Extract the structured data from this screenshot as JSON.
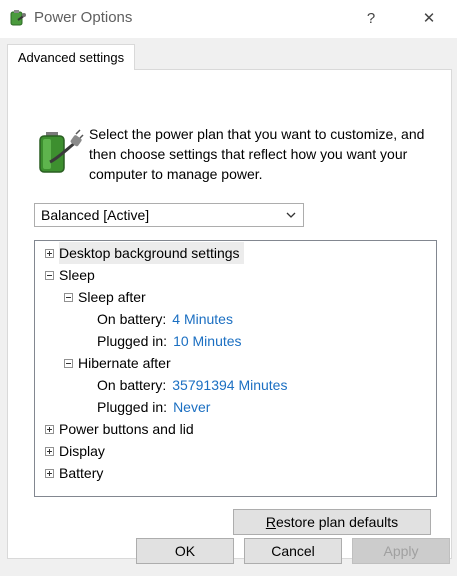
{
  "window": {
    "title": "Power Options",
    "help_label": "?",
    "close_label": "✕"
  },
  "tab": {
    "label": "Advanced settings"
  },
  "description": "Select the power plan that you want to customize, and then choose settings that reflect how you want your computer to manage power.",
  "plan_select": {
    "value": "Balanced [Active]"
  },
  "tree": {
    "desktop_background": "Desktop background settings",
    "sleep": "Sleep",
    "sleep_after": "Sleep after",
    "sleep_on_battery_label": "On battery:",
    "sleep_on_battery_value": "4 Minutes",
    "sleep_plugged_label": "Plugged in:",
    "sleep_plugged_value": "10 Minutes",
    "hibernate_after": "Hibernate after",
    "hibernate_on_battery_label": "On battery:",
    "hibernate_on_battery_value": "35791394 Minutes",
    "hibernate_plugged_label": "Plugged in:",
    "hibernate_plugged_value": "Never",
    "power_buttons": "Power buttons and lid",
    "display": "Display",
    "battery": "Battery"
  },
  "buttons": {
    "restore_first": "R",
    "restore_rest": "estore plan defaults",
    "ok": "OK",
    "cancel": "Cancel",
    "apply": "Apply"
  },
  "colors": {
    "value_link": "#1b6fc2",
    "dialog_bg": "#f0f0f0"
  }
}
